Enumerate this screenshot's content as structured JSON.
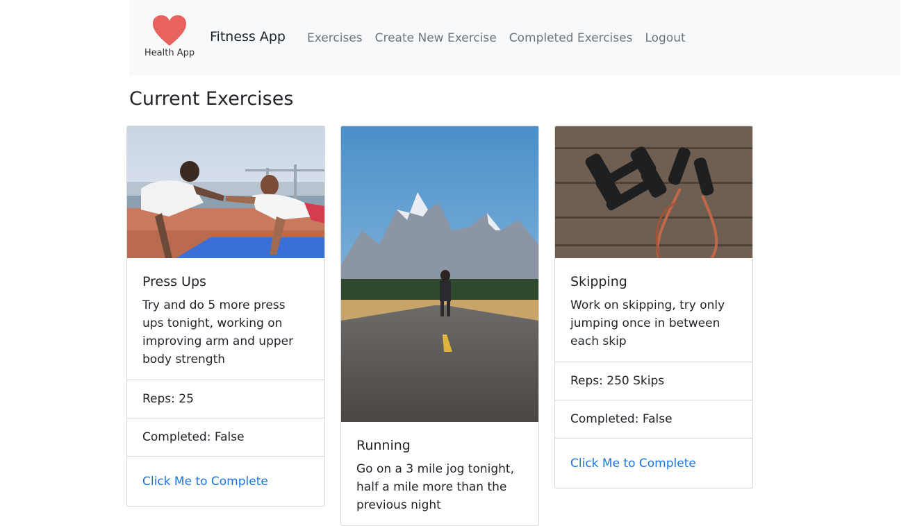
{
  "nav": {
    "logo_text": "Health App",
    "brand": "Fitness App",
    "links": [
      {
        "label": "Exercises"
      },
      {
        "label": "Create New Exercise"
      },
      {
        "label": "Completed Exercises"
      },
      {
        "label": "Logout"
      }
    ]
  },
  "page": {
    "title": "Current Exercises"
  },
  "exercises": [
    {
      "image_icon": "press-ups-photo",
      "title": "Press Ups",
      "description": "Try and do 5 more press ups tonight, working on improving arm and upper body strength",
      "reps": "Reps: 25",
      "completed": "Completed: False",
      "action": "Click Me to Complete"
    },
    {
      "image_icon": "running-road-photo",
      "title": "Running",
      "description": "Go on a 3 mile jog tonight, half a mile more than the previous night"
    },
    {
      "image_icon": "dumbbells-photo",
      "title": "Skipping",
      "description": "Work on skipping, try only jumping once in between each skip",
      "reps": "Reps: 250 Skips",
      "completed": "Completed: False",
      "action": "Click Me to Complete"
    }
  ],
  "colors": {
    "navbar_bg": "#f8f9fa",
    "heart": "#e8635e",
    "link": "#1a73e8",
    "nav_link": "#6c757d"
  }
}
